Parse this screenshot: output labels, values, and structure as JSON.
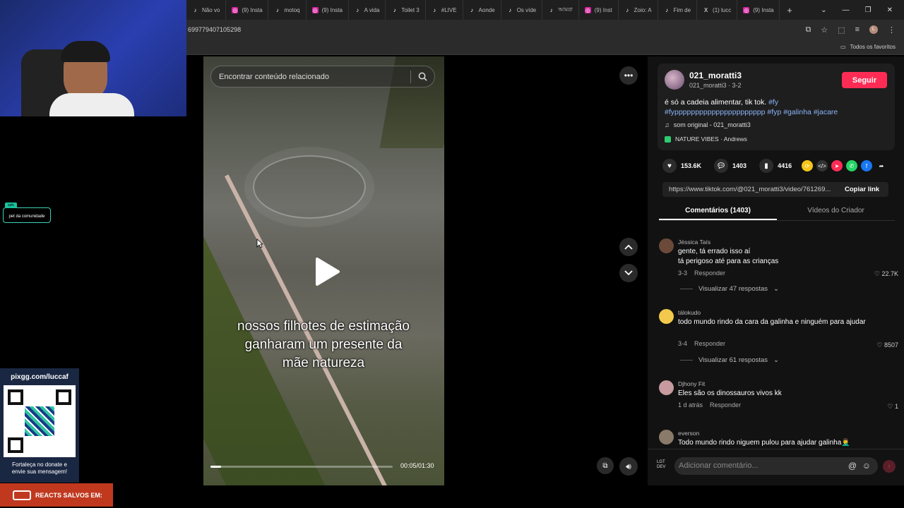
{
  "browser": {
    "tabs": [
      {
        "label": "Não vo",
        "icon": "tiktok-icon"
      },
      {
        "label": "(9) Insta",
        "icon": "instagram-icon"
      },
      {
        "label": "motoq",
        "icon": "tiktok-icon"
      },
      {
        "label": "(9) Insta",
        "icon": "instagram-icon"
      },
      {
        "label": "A vida",
        "icon": "tiktok-icon"
      },
      {
        "label": "Toilet 3",
        "icon": "tiktok-icon"
      },
      {
        "label": "#LIVE",
        "icon": "tiktok-icon"
      },
      {
        "label": "Aonde",
        "icon": "tiktok-icon"
      },
      {
        "label": "Os víde",
        "icon": "tiktok-icon"
      },
      {
        "label": "আমরা",
        "icon": "tiktok-icon"
      },
      {
        "label": "(9) Inst",
        "icon": "instagram-icon"
      },
      {
        "label": "Zoio: A",
        "icon": "tiktok-icon"
      },
      {
        "label": "Fim de",
        "icon": "tiktok-icon"
      },
      {
        "label": "(1) lucc",
        "icon": "x-icon"
      },
      {
        "label": "(9) Insta",
        "icon": "instagram-icon"
      }
    ],
    "url": "699779407105298",
    "bookmarks_label": "Todos os favoritos",
    "profile_initial": "L"
  },
  "overlay": {
    "pet_tag": "spik",
    "pet_label": "pet da comunidade",
    "donate_title": "pixgg.com/luccaf",
    "donate_message_1": "Fortaleça no donate e",
    "donate_message_2": "envie sua mensagem!",
    "reacts_label": "REACTS SALVOS EM:"
  },
  "video": {
    "search_placeholder": "Encontrar conteúdo relacionado",
    "caption_line1": "nossos filhotes de estimação",
    "caption_line2": "ganharam um presente da",
    "caption_line3": "mãe natureza",
    "time": "00:05/01:30",
    "progress": 0.06
  },
  "post": {
    "username": "021_moratti3",
    "subline": "021_moratti3 · 3-2",
    "follow_label": "Seguir",
    "description": "é só a cadeia alimentar, tik tok.",
    "tags": [
      "#fy",
      "#fypppppppppppppppppppppp",
      "#fyp",
      "#galinha",
      "#jacare"
    ],
    "music": "som original - 021_moratti3",
    "nature": "NATURE VIBES · Andrews",
    "likes": "153.6K",
    "comments": "1403",
    "saves": "4416",
    "link": "https://www.tiktok.com/@021_moratti3/video/761269...",
    "copy_label": "Copiar link",
    "tab_comments": "Comentários (1403)",
    "tab_creator": "Vídeos do Criador"
  },
  "comments": [
    {
      "name": "Jéssica Taís",
      "text": "gente, tá errado isso aí\ntá perigoso até para as crianças",
      "date": "3-3",
      "reply": "Responder",
      "likes": "22.7K",
      "replies": "Visualizar 47 respostas"
    },
    {
      "name": "tálokudo",
      "text": "todo mundo rindo da cara da galinha e ninguém para ajudar",
      "date": "3-4",
      "reply": "Responder",
      "likes": "8507",
      "replies": "Visualizar 61 respostas"
    },
    {
      "name": "Djhony Fit",
      "text": "Eles são os dinossauros vivos kk",
      "date": "1 d atrás",
      "reply": "Responder",
      "likes": "1"
    },
    {
      "name": "everson",
      "text": "Todo mundo rindo niguem pulou para ajudar galinha🤦‍♂️"
    }
  ],
  "input": {
    "placeholder": "Adicionar comentário...",
    "logo_text": "LGT DEV"
  },
  "colors": {
    "accent": "#fe2c55",
    "tag": "#8ab4f8"
  }
}
